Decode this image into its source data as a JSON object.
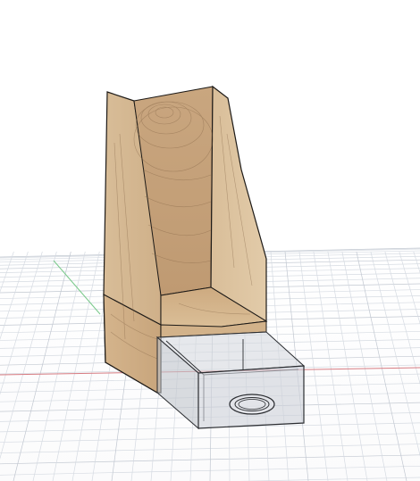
{
  "viewport": {
    "background": "#ffffff",
    "grid_color": "#d6dbe2",
    "grid_major_color": "#c2c8d1",
    "axis_x_color": "#d77c82",
    "axis_y_color": "#79c98a"
  },
  "model": {
    "wood_light": "#dcc3a0",
    "wood_mid": "#c6a27a",
    "wood_dark": "#a98560",
    "grain_color": "#7d5e40",
    "edge_color": "#1d1a17",
    "drawer_glass": "#c9ced6",
    "drawer_edge": "#2b2d31",
    "drawer_handle": "round-pull-icon"
  }
}
